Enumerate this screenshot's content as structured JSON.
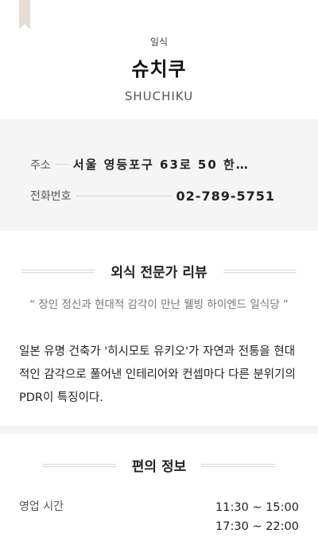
{
  "header": {
    "category": "일식",
    "name": "슈치쿠",
    "eng_name": "SHUCHIKU"
  },
  "info": {
    "address_label": "주소",
    "address_value": "서울 영등포구 63로 50 한…",
    "phone_label": "전화번호",
    "phone_value": "02-789-5751"
  },
  "review": {
    "title": "외식 전문가 리뷰",
    "quote": "“ 장인 정신과 현대적 감각이 만난 웰빙 하이엔드 일식당 ”",
    "body": "일본 유명 건축가 '히시모토 유키오'가 자연과 전통을 현대적인 감각으로 풀어낸 인테리어와 컨셉마다 다른 분위기의 PDR이 특징이다."
  },
  "convenience": {
    "title": "편의 정보",
    "hours_label": "영업 시간",
    "hours": [
      "11:30 ~ 15:00",
      "17:30 ~ 22:00"
    ]
  },
  "icons": {
    "bookmark": "bookmark-icon"
  },
  "colors": {
    "info_bg": "#f5f5f5",
    "bookmark": "#e3ddd3"
  }
}
